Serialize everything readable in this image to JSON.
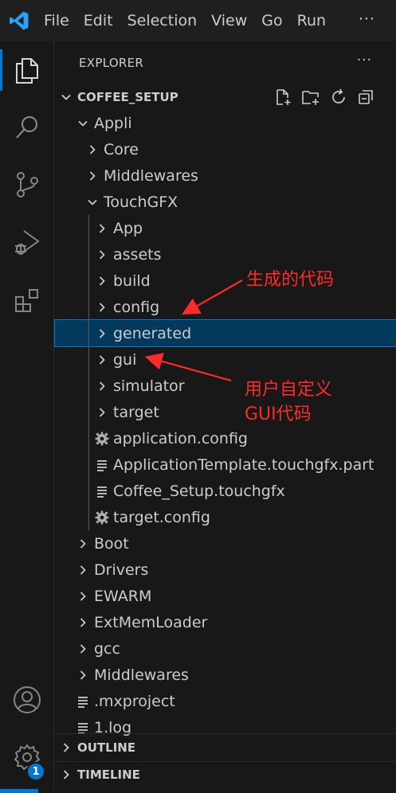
{
  "menu": {
    "items": [
      "File",
      "Edit",
      "Selection",
      "View",
      "Go",
      "Run"
    ],
    "more": "···"
  },
  "activity": {
    "badge": "1"
  },
  "explorer": {
    "title": "EXPLORER",
    "more": "···",
    "project": "COFFEE_SETUP",
    "outline": "OUTLINE",
    "timeline": "TIMELINE"
  },
  "tree": [
    {
      "label": "Appli",
      "level": 1,
      "kind": "folder-open"
    },
    {
      "label": "Core",
      "level": 2,
      "kind": "folder"
    },
    {
      "label": "Middlewares",
      "level": 2,
      "kind": "folder"
    },
    {
      "label": "TouchGFX",
      "level": 2,
      "kind": "folder-open"
    },
    {
      "label": "App",
      "level": 3,
      "kind": "folder"
    },
    {
      "label": "assets",
      "level": 3,
      "kind": "folder"
    },
    {
      "label": "build",
      "level": 3,
      "kind": "folder"
    },
    {
      "label": "config",
      "level": 3,
      "kind": "folder"
    },
    {
      "label": "generated",
      "level": 3,
      "kind": "folder",
      "selected": true
    },
    {
      "label": "gui",
      "level": 3,
      "kind": "folder"
    },
    {
      "label": "simulator",
      "level": 3,
      "kind": "folder"
    },
    {
      "label": "target",
      "level": 3,
      "kind": "folder"
    },
    {
      "label": "application.config",
      "level": 3,
      "kind": "gear"
    },
    {
      "label": "ApplicationTemplate.touchgfx.part",
      "level": 3,
      "kind": "lines"
    },
    {
      "label": "Coffee_Setup.touchgfx",
      "level": 3,
      "kind": "lines"
    },
    {
      "label": "target.config",
      "level": 3,
      "kind": "gear"
    },
    {
      "label": "Boot",
      "level": 1,
      "kind": "folder"
    },
    {
      "label": "Drivers",
      "level": 1,
      "kind": "folder"
    },
    {
      "label": "EWARM",
      "level": 1,
      "kind": "folder"
    },
    {
      "label": "ExtMemLoader",
      "level": 1,
      "kind": "folder"
    },
    {
      "label": "gcc",
      "level": 1,
      "kind": "folder"
    },
    {
      "label": "Middlewares",
      "level": 1,
      "kind": "folder"
    },
    {
      "label": ".mxproject",
      "level": 1,
      "kind": "lines"
    },
    {
      "label": "1.log",
      "level": 1,
      "kind": "lines"
    }
  ],
  "annotations": {
    "generated_note": "生成的代码",
    "gui_note_line1": "用户自定义",
    "gui_note_line2": "GUI代码"
  },
  "colors": {
    "accent": "#0078d4",
    "selection_bg": "#04395e",
    "annotation": "#ff2a2a"
  }
}
